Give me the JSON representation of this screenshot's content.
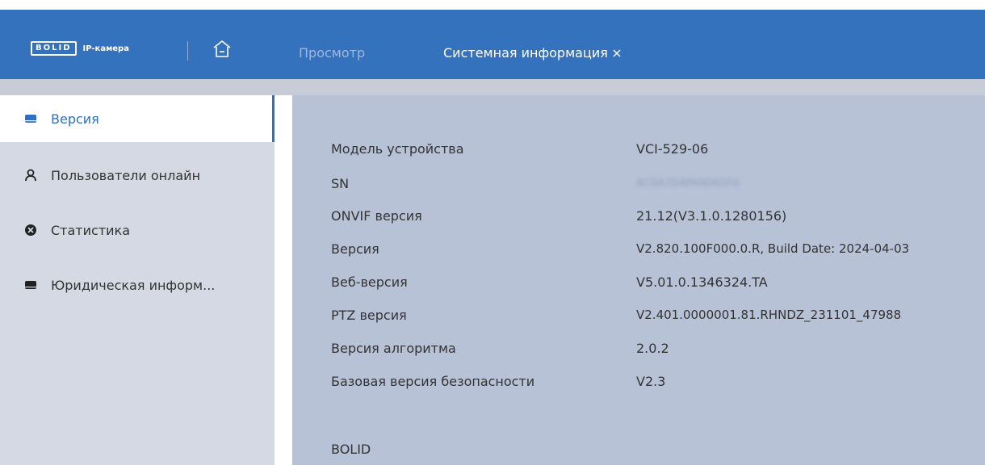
{
  "header": {
    "logo_text": "BOLID",
    "logo_subtitle": "IP-камера",
    "tabs": [
      {
        "label": "Просмотр"
      },
      {
        "label": "Системная информация"
      }
    ]
  },
  "sidebar": {
    "items": [
      {
        "label": "Версия",
        "icon": "drive-icon",
        "active": true
      },
      {
        "label": "Пользователи онлайн",
        "icon": "user-icon",
        "active": false
      },
      {
        "label": "Статистика",
        "icon": "stats-icon",
        "active": false
      },
      {
        "label": "Юридическая информ...",
        "icon": "legal-icon",
        "active": false
      }
    ]
  },
  "info": {
    "rows": [
      {
        "key": "Модель устройства",
        "value": "VCI-529-06"
      },
      {
        "key": "SN",
        "value": "AC0A7D4PAN065F0"
      },
      {
        "key": "ONVIF версия",
        "value": "21.12(V3.1.0.1280156)"
      },
      {
        "key": "Версия",
        "value": "V2.820.100F000.0.R, Build Date: 2024-04-03"
      },
      {
        "key": "Веб-версия",
        "value": "V5.01.0.1346324.TA"
      },
      {
        "key": "PTZ версия",
        "value": "V2.401.0000001.81.RHNDZ_231101_47988"
      },
      {
        "key": "Версия алгоритма",
        "value": "2.0.2"
      },
      {
        "key": "Базовая версия безопасности",
        "value": "V2.3"
      }
    ],
    "footer": "BOLID"
  },
  "colors": {
    "header_bg": "#3572be",
    "accent": "#2d6fc2",
    "sidebar_bg": "#d4d9e3",
    "content_bg": "#b7c2d7"
  }
}
